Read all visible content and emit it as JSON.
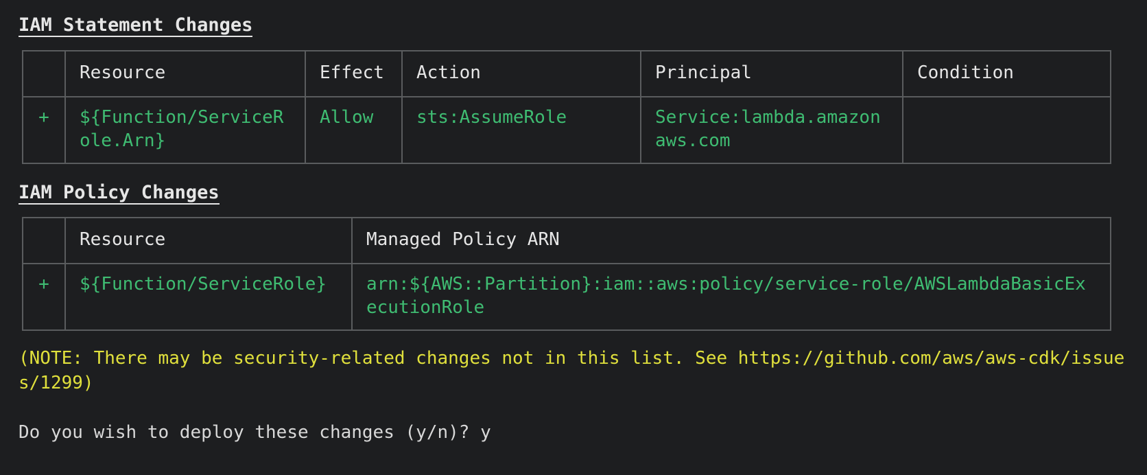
{
  "theme": {
    "background": "#1d1e20",
    "foreground": "#e6e6e6",
    "added_green": "#3fbc72",
    "warning_yellow": "#e0e03c",
    "border": "#5a5c5e"
  },
  "sections": {
    "iam_statement": {
      "title": "IAM Statement Changes",
      "columns": [
        "",
        "Resource",
        "Effect",
        "Action",
        "Principal",
        "Condition"
      ],
      "rows": [
        {
          "marker": "+",
          "resource": "${Function/ServiceRole.Arn}",
          "effect": "Allow",
          "action": "sts:AssumeRole",
          "principal": "Service:lambda.amazonaws.com",
          "condition": ""
        }
      ]
    },
    "iam_policy": {
      "title": "IAM Policy Changes",
      "columns": [
        "",
        "Resource",
        "Managed Policy ARN"
      ],
      "rows": [
        {
          "marker": "+",
          "resource": "${Function/ServiceRole}",
          "managed_policy_arn": "arn:${AWS::Partition}:iam::aws:policy/service-role/AWSLambdaBasicExecutionRole"
        }
      ]
    }
  },
  "note": "(NOTE: There may be security-related changes not in this list. See https://github.com/aws/aws-cdk/issues/1299)",
  "prompt": {
    "question": "Do you wish to deploy these changes (y/n)? ",
    "answer": "y",
    "full_line": "Do you wish to deploy these changes (y/n)? y"
  }
}
